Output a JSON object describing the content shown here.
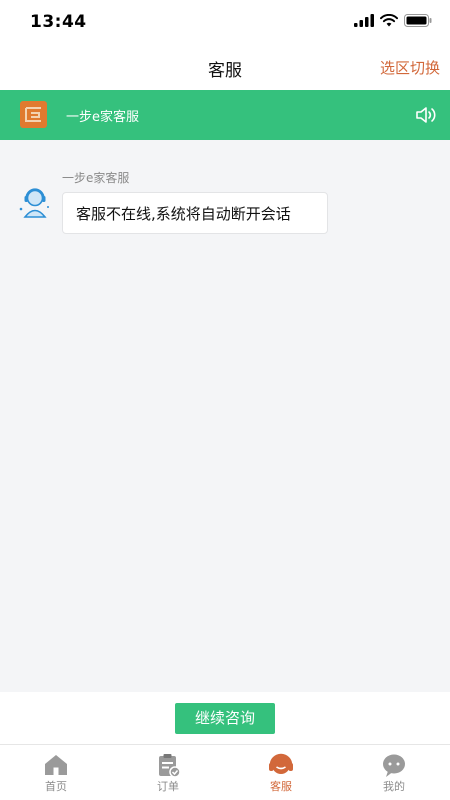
{
  "status_bar": {
    "time": "13:44"
  },
  "nav": {
    "title": "客服",
    "action": "选区切换"
  },
  "notice": {
    "text": "一步e家客服"
  },
  "chat": {
    "messages": [
      {
        "sender": "一步e家客服",
        "text": "客服不在线,系统将自动断开会话"
      }
    ]
  },
  "bottom": {
    "continue_label": "继续咨询"
  },
  "tabs": [
    {
      "label": "首页",
      "icon": "home-icon",
      "active": false
    },
    {
      "label": "订单",
      "icon": "order-icon",
      "active": false
    },
    {
      "label": "客服",
      "icon": "customer-service-icon",
      "active": true
    },
    {
      "label": "我的",
      "icon": "profile-icon",
      "active": false
    }
  ],
  "colors": {
    "accent": "#35c17d",
    "active_tab": "#d2683a",
    "logo": "#e07a2f"
  }
}
